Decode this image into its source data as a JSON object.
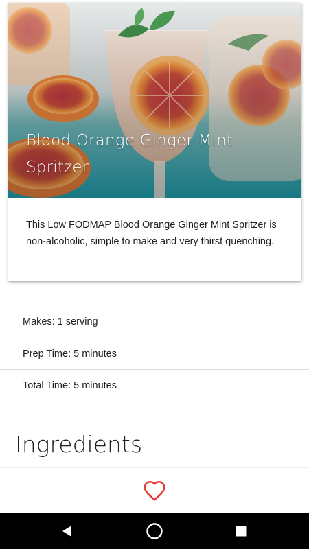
{
  "recipe": {
    "title": "Blood Orange Ginger Mint Spritzer",
    "description": "This Low FODMAP Blood Orange Ginger Mint Spritzer is non-alcoholic, simple to make and very thirst quenching."
  },
  "details": {
    "makes": "Makes: 1 serving",
    "prep_time": "Prep Time: 5 minutes",
    "total_time": "Total Time: 5 minutes"
  },
  "sections": {
    "ingredients_heading": "Ingredients"
  },
  "actions": {
    "favorite_icon": "heart-outline-icon",
    "favorite_color": "#e53935"
  },
  "system_nav": {
    "back_icon": "back-triangle-icon",
    "home_icon": "home-circle-icon",
    "recents_icon": "recents-square-icon"
  }
}
